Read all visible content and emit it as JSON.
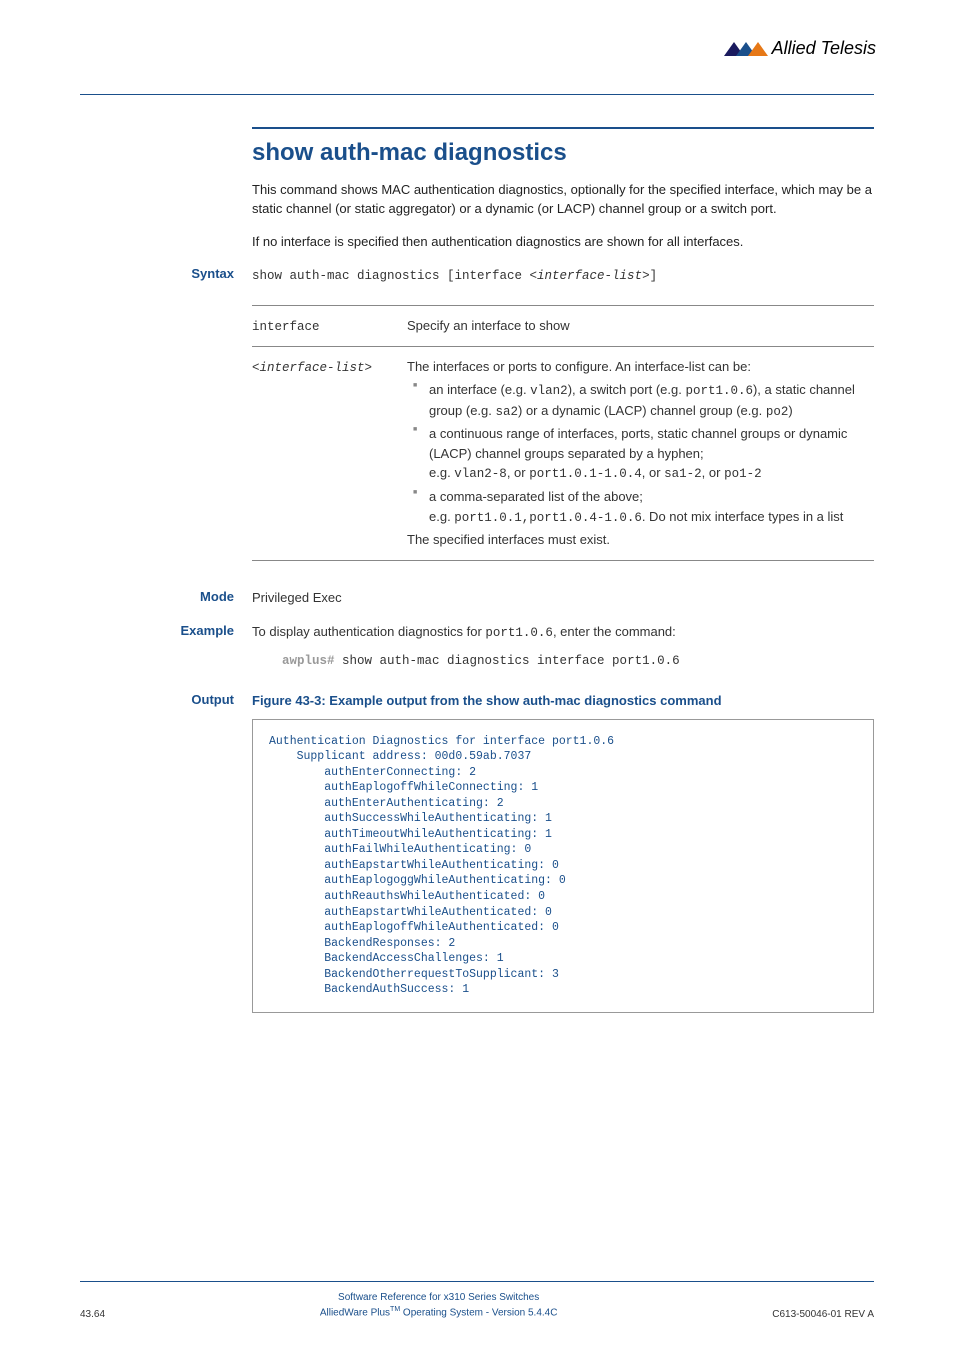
{
  "brand": "Allied Telesis",
  "title": "show auth-mac diagnostics",
  "intro1": "This command shows MAC authentication diagnostics, optionally for the specified interface, which may be a static channel (or static aggregator) or a dynamic (or LACP) channel group or a switch port.",
  "intro2": "If no interface is specified then authentication diagnostics are shown for all interfaces.",
  "syntax": {
    "label": "Syntax",
    "cmd_prefix": "show auth-mac diagnostics [interface <",
    "cmd_param": "interface-list",
    "cmd_suffix": ">]"
  },
  "params": {
    "row1": {
      "name": "interface",
      "desc": "Specify an interface to show"
    },
    "row2": {
      "name": "<interface-list>",
      "lead": "The interfaces or ports to configure. An interface-list can be:",
      "b1_pre": "an interface (e.g. ",
      "b1_c1": "vlan2",
      "b1_mid1": "), a switch port (e.g. ",
      "b1_c2": "port1.0.6",
      "b1_mid2": "), a static channel group (e.g. ",
      "b1_c3": "sa2",
      "b1_mid3": ") or a dynamic (LACP) channel group (e.g. ",
      "b1_c4": "po2",
      "b1_end": ")",
      "b2_pre": "a continuous range of interfaces, ports, static channel groups or dynamic (LACP) channel groups separated by a hyphen;",
      "b2_eg_pre": "e.g. ",
      "b2_c1": "vlan2-8",
      "b2_or1": ", or ",
      "b2_c2": "port1.0.1-1.0.4",
      "b2_or2": ", or ",
      "b2_c3": "sa1-2",
      "b2_or3": ", or ",
      "b2_c4": "po1-2",
      "b3_pre": "a comma-separated list of the above;",
      "b3_eg_pre": "e.g. ",
      "b3_c1": "port1.0.1,port1.0.4-1.0.6",
      "b3_end": ". Do not mix interface types in a list",
      "tail": "The specified interfaces must exist."
    }
  },
  "mode": {
    "label": "Mode",
    "value": "Privileged Exec"
  },
  "example": {
    "label": "Example",
    "text_pre": "To display authentication diagnostics for ",
    "text_port": "port1.0.6",
    "text_post": ", enter the command:",
    "prompt": "awplus#",
    "cmd": " show auth-mac diagnostics interface port1.0.6"
  },
  "output": {
    "label": "Output",
    "figure_title": "Figure 43-3: Example output from the show auth-mac diagnostics command",
    "text": "Authentication Diagnostics for interface port1.0.6\n    Supplicant address: 00d0.59ab.7037\n        authEnterConnecting: 2\n        authEaplogoffWhileConnecting: 1\n        authEnterAuthenticating: 2\n        authSuccessWhileAuthenticating: 1\n        authTimeoutWhileAuthenticating: 1\n        authFailWhileAuthenticating: 0\n        authEapstartWhileAuthenticating: 0\n        authEaplogoggWhileAuthenticating: 0\n        authReauthsWhileAuthenticated: 0\n        authEapstartWhileAuthenticated: 0\n        authEaplogoffWhileAuthenticated: 0\n        BackendResponses: 2\n        BackendAccessChallenges: 1\n        BackendOtherrequestToSupplicant: 3\n        BackendAuthSuccess: 1"
  },
  "footer": {
    "left": "43.64",
    "center1": "Software Reference for x310 Series Switches",
    "center2_pre": "AlliedWare Plus",
    "center2_sup": "TM",
    "center2_post": " Operating System  - Version 5.4.4C",
    "right": "C613-50046-01 REV A"
  }
}
